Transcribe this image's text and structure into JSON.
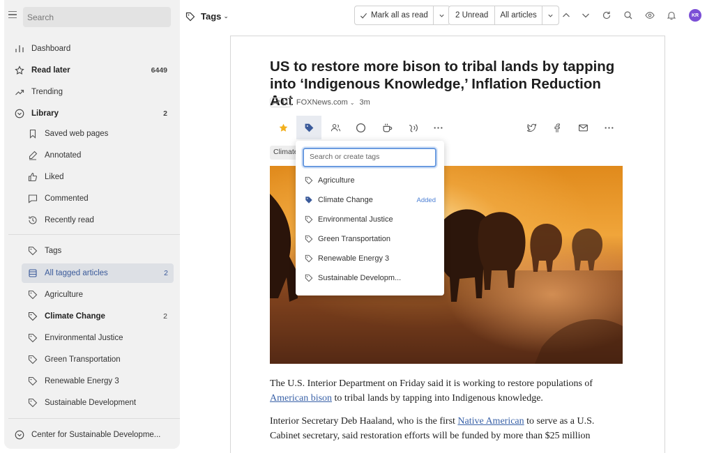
{
  "sidebar": {
    "search_placeholder": "Search",
    "dashboard": "Dashboard",
    "read_later": {
      "label": "Read later",
      "count": "6449"
    },
    "trending": "Trending",
    "library": {
      "label": "Library",
      "count": "2"
    },
    "library_items": [
      "Saved web pages",
      "Annotated",
      "Liked",
      "Commented",
      "Recently read"
    ],
    "tags_header": "Tags",
    "all_tagged": {
      "label": "All tagged articles",
      "count": "2"
    },
    "tags": [
      {
        "label": "Agriculture",
        "count": ""
      },
      {
        "label": "Climate Change",
        "count": "2"
      },
      {
        "label": "Environmental Justice",
        "count": ""
      },
      {
        "label": "Green Transportation",
        "count": ""
      },
      {
        "label": "Renewable Energy 3",
        "count": ""
      },
      {
        "label": "Sustainable Development",
        "count": ""
      }
    ],
    "footer": "Center for Sustainable Developme..."
  },
  "topbar": {
    "title": "Tags",
    "mark_all_read": "Mark all as read",
    "unread": "2 Unread",
    "all_articles": "All articles",
    "avatar_initials": "KR",
    "avatar_color": "#7b4fd6"
  },
  "article": {
    "headline": "US to restore more bison to tribal lands by tapping into ‘Indigenous Knowledge,’ Inflation Reduction Act",
    "trend_count": "11",
    "source": "FOXNews.com",
    "age": "3m",
    "tag_chip": "Climate Change",
    "p1_before": "The U.S. Interior Department on Friday said it is working to restore populations of ",
    "p1_link": "American bison",
    "p1_after": " to tribal lands by tapping into Indigenous knowledge.",
    "p2_before": "Interior Secretary Deb Haaland, who is the first ",
    "p2_link": "Native American",
    "p2_after": " to serve as a U.S. Cabinet secretary, said restoration efforts will be funded by more than $25 million"
  },
  "tag_dropdown": {
    "search_placeholder": "Search or create tags",
    "options": [
      {
        "label": "Agriculture",
        "status": ""
      },
      {
        "label": "Climate Change",
        "status": "Added"
      },
      {
        "label": "Environmental Justice",
        "status": ""
      },
      {
        "label": "Green Transportation",
        "status": ""
      },
      {
        "label": "Renewable Energy 3",
        "status": ""
      },
      {
        "label": "Sustainable Developm...",
        "status": ""
      }
    ]
  },
  "colors": {
    "accent": "#3a5a9a",
    "link": "#3a62a8",
    "star": "#f2b01e",
    "added": "#4b7fd4"
  }
}
